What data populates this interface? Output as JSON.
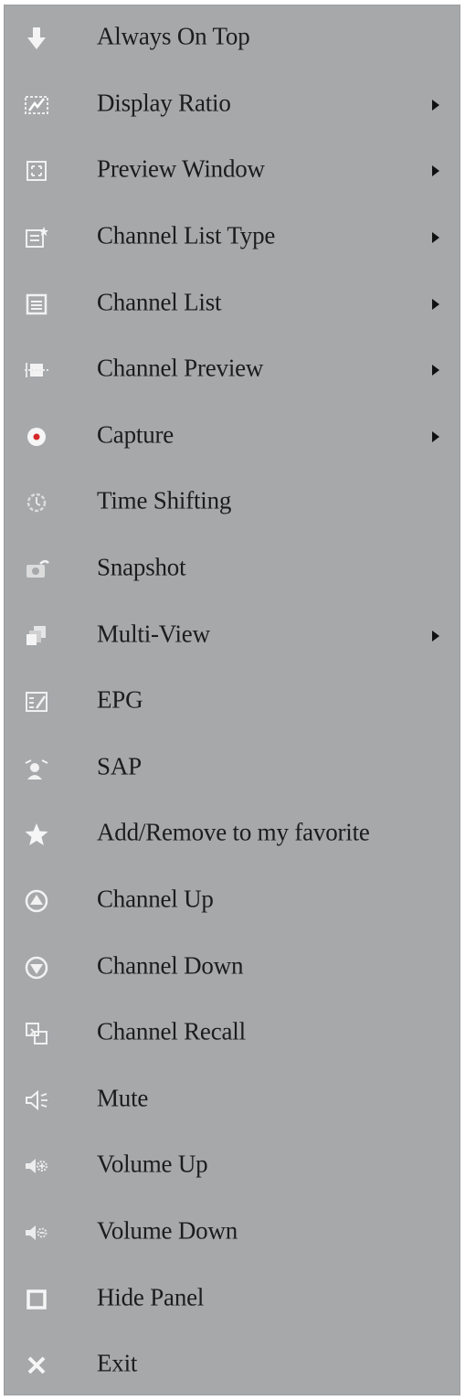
{
  "menu": {
    "items": [
      {
        "label": "Always On Top",
        "icon": "arrow-down-icon",
        "submenu": false
      },
      {
        "label": "Display Ratio",
        "icon": "display-ratio-icon",
        "submenu": true
      },
      {
        "label": "Preview Window",
        "icon": "preview-window-icon",
        "submenu": true
      },
      {
        "label": "Channel List Type",
        "icon": "list-type-icon",
        "submenu": true
      },
      {
        "label": "Channel List",
        "icon": "channel-list-icon",
        "submenu": true
      },
      {
        "label": "Channel Preview",
        "icon": "channel-preview-icon",
        "submenu": true
      },
      {
        "label": "Capture",
        "icon": "record-icon",
        "submenu": true
      },
      {
        "label": "Time Shifting",
        "icon": "time-shift-icon",
        "submenu": false
      },
      {
        "label": "Snapshot",
        "icon": "camera-icon",
        "submenu": false
      },
      {
        "label": "Multi-View",
        "icon": "multi-view-icon",
        "submenu": true
      },
      {
        "label": "EPG",
        "icon": "epg-icon",
        "submenu": false
      },
      {
        "label": "SAP",
        "icon": "sap-icon",
        "submenu": false
      },
      {
        "label": "Add/Remove to my favorite",
        "icon": "star-icon",
        "submenu": false
      },
      {
        "label": "Channel Up",
        "icon": "channel-up-icon",
        "submenu": false
      },
      {
        "label": "Channel Down",
        "icon": "channel-down-icon",
        "submenu": false
      },
      {
        "label": "Channel Recall",
        "icon": "recall-icon",
        "submenu": false
      },
      {
        "label": "Mute",
        "icon": "mute-icon",
        "submenu": false
      },
      {
        "label": "Volume Up",
        "icon": "volume-up-icon",
        "submenu": false
      },
      {
        "label": "Volume Down",
        "icon": "volume-down-icon",
        "submenu": false
      },
      {
        "label": "Hide Panel",
        "icon": "square-icon",
        "submenu": false
      },
      {
        "label": "Exit",
        "icon": "close-icon",
        "submenu": false
      }
    ],
    "colors": {
      "background": "#a6a8aa",
      "text": "#1c1c1c",
      "icon": "#f2f2f2",
      "accent": "#d62828"
    }
  }
}
